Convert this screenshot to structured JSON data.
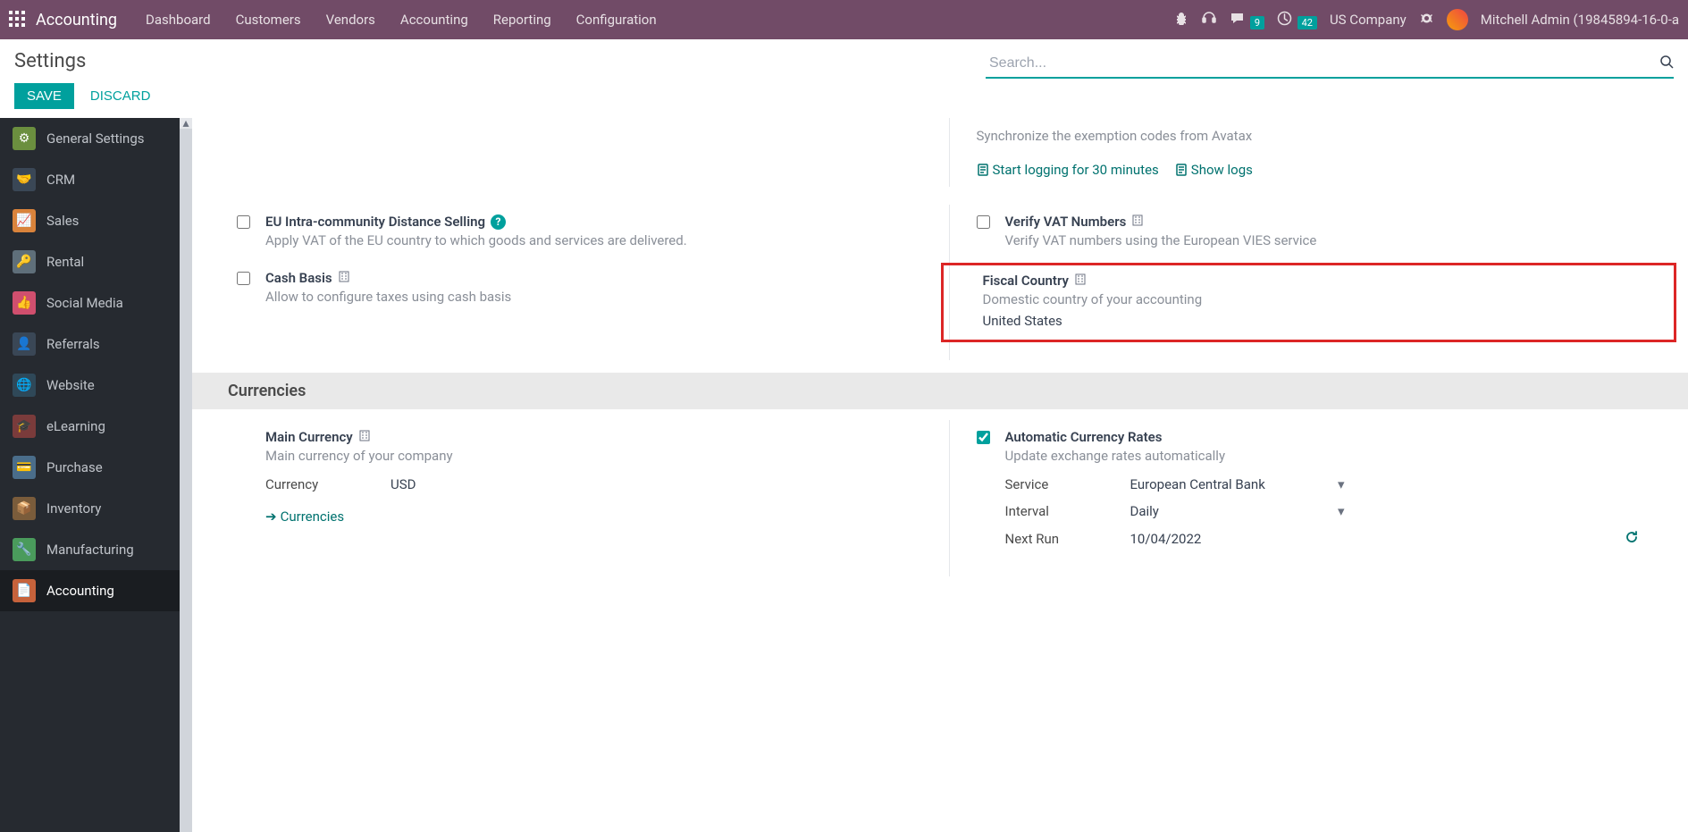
{
  "navbar": {
    "brand": "Accounting",
    "menu": [
      "Dashboard",
      "Customers",
      "Vendors",
      "Accounting",
      "Reporting",
      "Configuration"
    ],
    "msg_count": "9",
    "activity_count": "42",
    "company": "US Company",
    "username": "Mitchell Admin (19845894-16-0-a"
  },
  "control": {
    "title": "Settings",
    "save": "SAVE",
    "discard": "DISCARD",
    "search_placeholder": "Search..."
  },
  "sidebar": {
    "items": [
      {
        "label": "General Settings",
        "color": "#6b8f3f"
      },
      {
        "label": "CRM",
        "color": "#3a4756"
      },
      {
        "label": "Sales",
        "color": "#d9833b"
      },
      {
        "label": "Rental",
        "color": "#5f6f7a"
      },
      {
        "label": "Social Media",
        "color": "#d04f6e"
      },
      {
        "label": "Referrals",
        "color": "#3a4756"
      },
      {
        "label": "Website",
        "color": "#2f4858"
      },
      {
        "label": "eLearning",
        "color": "#7a3b3b"
      },
      {
        "label": "Purchase",
        "color": "#4a6d8a"
      },
      {
        "label": "Inventory",
        "color": "#7a5c3b"
      },
      {
        "label": "Manufacturing",
        "color": "#4a9b5c"
      },
      {
        "label": "Accounting",
        "color": "#c6623b"
      }
    ]
  },
  "settings": {
    "avatax_sync": "Synchronize the exemption codes from Avatax",
    "start_logging": "Start logging for 30 minutes",
    "show_logs": "Show logs",
    "eu_distance": {
      "title": "EU Intra-community Distance Selling",
      "desc": "Apply VAT of the EU country to which goods and services are delivered."
    },
    "verify_vat": {
      "title": "Verify VAT Numbers",
      "desc": "Verify VAT numbers using the European VIES service"
    },
    "cash_basis": {
      "title": "Cash Basis",
      "desc": "Allow to configure taxes using cash basis"
    },
    "fiscal_country": {
      "title": "Fiscal Country",
      "desc": "Domestic country of your accounting",
      "value": "United States"
    },
    "currencies_header": "Currencies",
    "main_currency": {
      "title": "Main Currency",
      "desc": "Main currency of your company",
      "currency_label": "Currency",
      "currency_value": "USD",
      "currencies_link": "Currencies"
    },
    "auto_rates": {
      "title": "Automatic Currency Rates",
      "desc": "Update exchange rates automatically",
      "service_label": "Service",
      "service_value": "European Central Bank",
      "interval_label": "Interval",
      "interval_value": "Daily",
      "next_run_label": "Next Run",
      "next_run_value": "10/04/2022"
    }
  }
}
